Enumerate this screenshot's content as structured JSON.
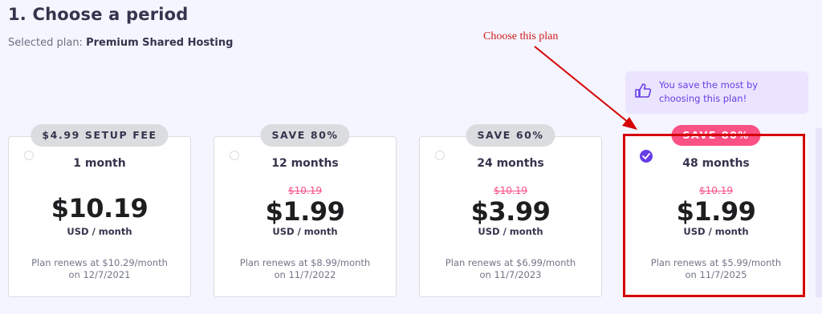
{
  "header": {
    "title": "1. Choose a period",
    "selected_prefix": "Selected plan:",
    "selected_plan": "Premium Shared Hosting"
  },
  "annotation": {
    "text": "Choose this plan",
    "color": "#d11919"
  },
  "tip": {
    "line1": "You save the most by",
    "line2": "choosing this plan!",
    "icon": "thumbs-up-icon"
  },
  "colors": {
    "accent": "#673de6",
    "sale": "#fc5185",
    "annotation_red": "#d60000"
  },
  "plans": [
    {
      "badge": "$4.99 SETUP FEE",
      "period": "1 month",
      "old_price": "",
      "price": "$10.19",
      "unit": "USD / month",
      "renew1": "Plan renews at $10.29/month",
      "renew2": "on 12/7/2021",
      "selected": false
    },
    {
      "badge": "SAVE 80%",
      "period": "12 months",
      "old_price": "$10.19",
      "price": "$1.99",
      "unit": "USD / month",
      "renew1": "Plan renews at $8.99/month",
      "renew2": "on 11/7/2022",
      "selected": false
    },
    {
      "badge": "SAVE 60%",
      "period": "24 months",
      "old_price": "$10.19",
      "price": "$3.99",
      "unit": "USD / month",
      "renew1": "Plan renews at $6.99/month",
      "renew2": "on 11/7/2023",
      "selected": false
    },
    {
      "badge": "SAVE 80%",
      "period": "48 months",
      "old_price": "$10.19",
      "price": "$1.99",
      "unit": "USD / month",
      "renew1": "Plan renews at $5.99/month",
      "renew2": "on 11/7/2025",
      "selected": true
    }
  ]
}
